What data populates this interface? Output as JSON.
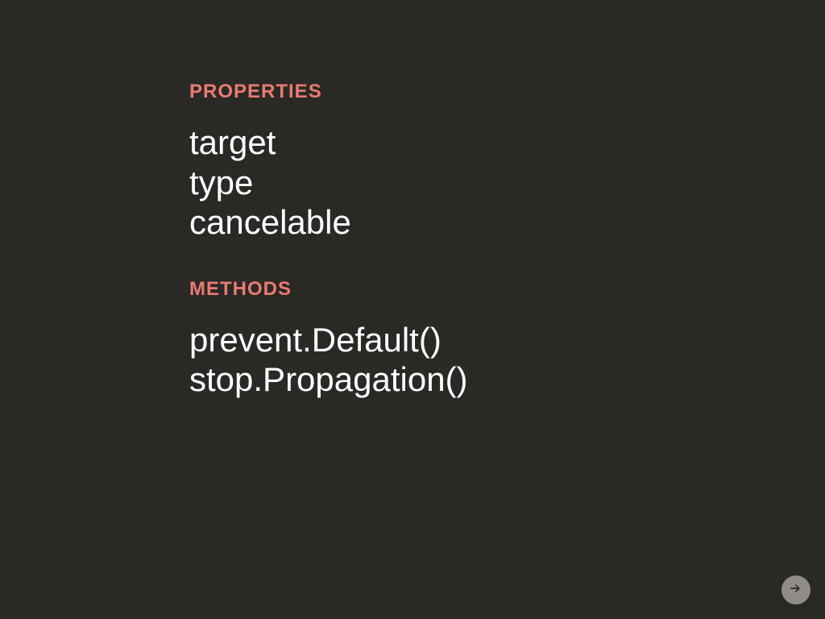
{
  "sections": [
    {
      "heading": "PROPERTIES",
      "items": [
        "target",
        "type",
        "cancelable"
      ]
    },
    {
      "heading": "METHODS",
      "items": [
        "prevent.Default()",
        "stop.Propagation()"
      ]
    }
  ],
  "nav": {
    "next_icon": "arrow-right-circle"
  }
}
